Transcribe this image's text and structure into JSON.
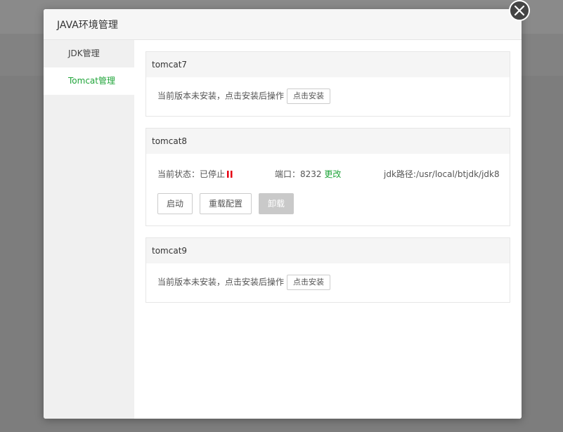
{
  "modal": {
    "title": "JAVA环境管理"
  },
  "sidebar": {
    "items": [
      {
        "label": "JDK管理",
        "active": false
      },
      {
        "label": "Tomcat管理",
        "active": true
      }
    ]
  },
  "tomcat7": {
    "title": "tomcat7",
    "message": "当前版本未安装，点击安装后操作",
    "install_label": "点击安装"
  },
  "tomcat8": {
    "title": "tomcat8",
    "status_label": "当前状态：",
    "status_value": "已停止",
    "port_label": "端口：",
    "port_value": "8232",
    "change_label": "更改",
    "jdk_label": "jdk路径:",
    "jdk_path": "/usr/local/btjdk/jdk8",
    "buttons": {
      "start": "启动",
      "reload": "重载配置",
      "uninstall": "卸载"
    }
  },
  "tomcat9": {
    "title": "tomcat9",
    "message": "当前版本未安装，点击安装后操作",
    "install_label": "点击安装"
  },
  "colors": {
    "accent": "#20a53a",
    "stopped": "#e60012"
  },
  "icons": {
    "close": "close-icon",
    "status": "pause-icon"
  }
}
